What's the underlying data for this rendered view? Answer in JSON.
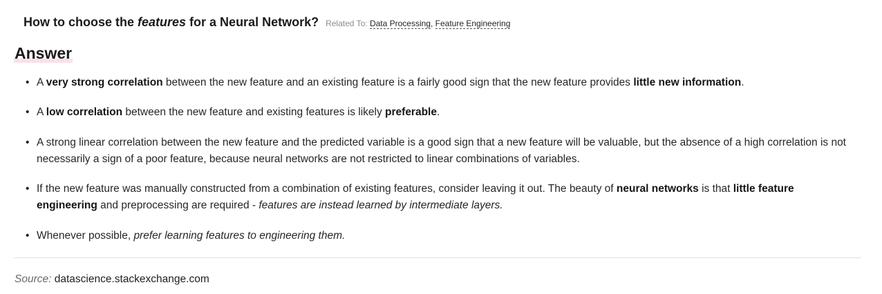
{
  "question": {
    "title_pre": "How to choose the ",
    "title_em": "features",
    "title_post": " for a Neural Network?",
    "related_label": "Related To:",
    "related_links": [
      "Data Processing",
      "Feature Engineering"
    ],
    "related_separator": ", "
  },
  "answer_heading": "Answer",
  "items": [
    {
      "bullet": "•",
      "s1": "A ",
      "b1": "very strong correlation",
      "s2": " between the new feature and an existing feature is a fairly good sign that the new feature provides ",
      "b2": "little new information",
      "s3": "."
    },
    {
      "bullet": "•",
      "s1": "A ",
      "b1": "low correlation",
      "s2": " between the new feature and existing features is likely ",
      "b2": "preferable",
      "s3": "."
    },
    {
      "bullet": "•",
      "s1": "A strong linear correlation between the new feature and the predicted variable is a good sign that a new feature will be valuable, but the absence of a high correlation is not necessarily a sign of a poor feature, because neural networks are not restricted to linear combinations of variables."
    },
    {
      "bullet": "•",
      "s1": "If the new feature was manually constructed from a combination of existing features, consider leaving it out. The beauty of ",
      "b1": "neural networks",
      "s2": " is that ",
      "b2": "little feature engineering",
      "s3": " and preprocessing are required - ",
      "i1": "features are instead learned by intermediate layers."
    },
    {
      "bullet": "•",
      "s1": "Whenever possible, ",
      "i1": "prefer learning features to engineering them."
    }
  ],
  "source": {
    "label": "Source:",
    "value": " datascience.stackexchange.com"
  }
}
